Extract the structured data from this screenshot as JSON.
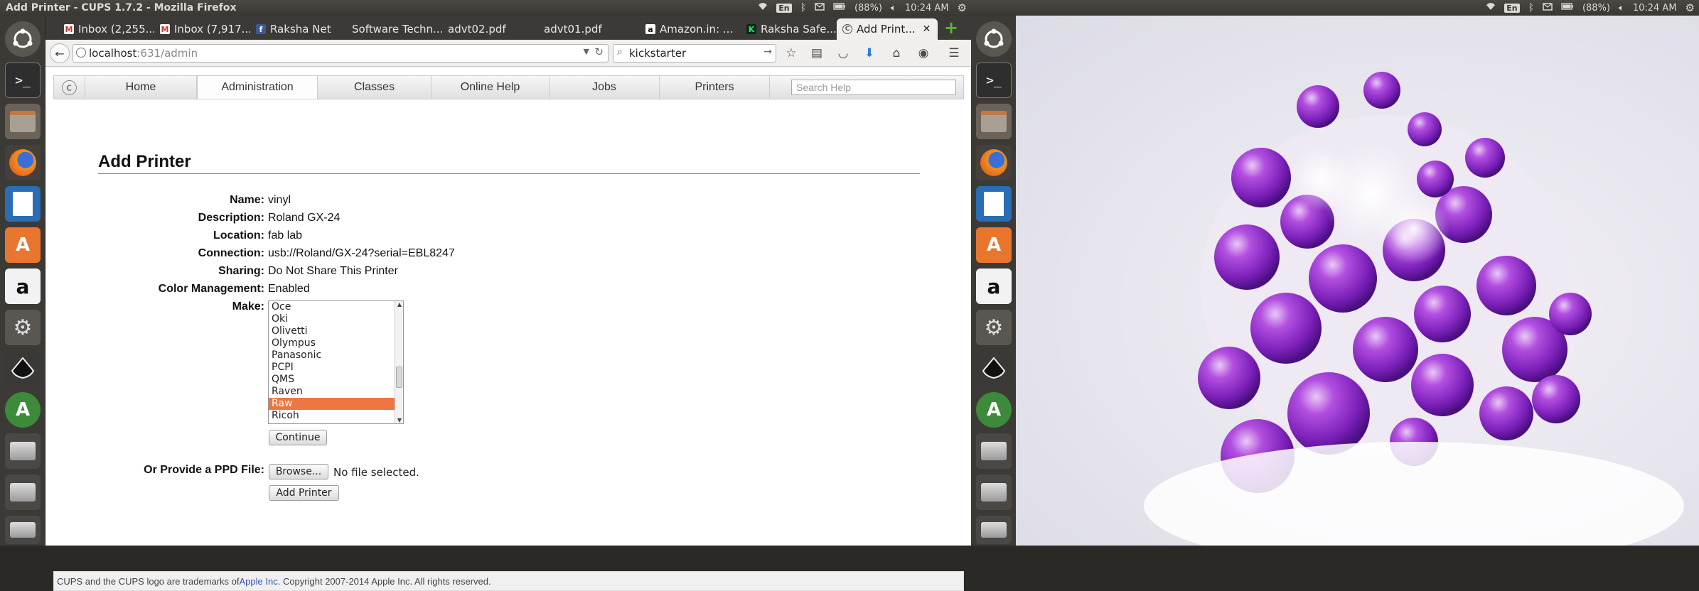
{
  "left_screen": {
    "window_title": "Add Printer - CUPS 1.7.2 - Mozilla Firefox",
    "indicators": {
      "keyboard": "En",
      "battery": "(88%)",
      "time": "10:24 AM"
    }
  },
  "right_screen": {
    "indicators": {
      "keyboard": "En",
      "battery": "(88%)",
      "time": "10:24 AM"
    }
  },
  "launcher_items": [
    "dash-home",
    "terminal",
    "files",
    "firefox",
    "libreoffice-writer",
    "ubuntu-software-center",
    "amazon",
    "system-settings",
    "inkscape",
    "software-updater",
    "drive",
    "drive",
    "drive"
  ],
  "browser": {
    "tabs": [
      {
        "label": "Inbox (2,255...",
        "icon": "gmail-icon"
      },
      {
        "label": "Inbox (7,917...",
        "icon": "gmail-icon"
      },
      {
        "label": "Raksha Net",
        "icon": "facebook-icon"
      },
      {
        "label": "Software Techn...",
        "icon": ""
      },
      {
        "label": "advt02.pdf",
        "icon": ""
      },
      {
        "label": "advt01.pdf",
        "icon": ""
      },
      {
        "label": "Amazon.in: ...",
        "icon": "amazon-icon"
      },
      {
        "label": "Raksha Safe...",
        "icon": "kickstarter-icon"
      },
      {
        "label": "Add Print...",
        "icon": "cups-icon"
      }
    ],
    "url_host": "localhost",
    "url_path": ":631/admin",
    "search_value": "kickstarter"
  },
  "cups": {
    "nav": [
      "Home",
      "Administration",
      "Classes",
      "Online Help",
      "Jobs",
      "Printers"
    ],
    "search_placeholder": "Search Help",
    "page_title": "Add Printer",
    "fields": {
      "name_label": "Name:",
      "name_value": "vinyl",
      "description_label": "Description:",
      "description_value": "Roland GX-24",
      "location_label": "Location:",
      "location_value": "fab lab",
      "connection_label": "Connection:",
      "connection_value": "usb://Roland/GX-24?serial=EBL8247",
      "sharing_label": "Sharing:",
      "sharing_value": "Do Not Share This Printer",
      "color_label": "Color Management:",
      "color_value": "Enabled",
      "make_label": "Make:"
    },
    "make_options": [
      "Oce",
      "Oki",
      "Olivetti",
      "Olympus",
      "Panasonic",
      "PCPI",
      "QMS",
      "Raven",
      "Raw",
      "Ricoh"
    ],
    "make_selected": "Raw",
    "continue_label": "Continue",
    "ppd_label": "Or Provide a PPD File:",
    "browse_label": "Browse...",
    "no_file_text": "No file selected.",
    "add_printer_label": "Add Printer",
    "footer_prefix": "CUPS and the CUPS logo are trademarks of ",
    "footer_link": "Apple Inc",
    "footer_suffix": ". Copyright 2007-2014 Apple Inc. All rights reserved."
  }
}
